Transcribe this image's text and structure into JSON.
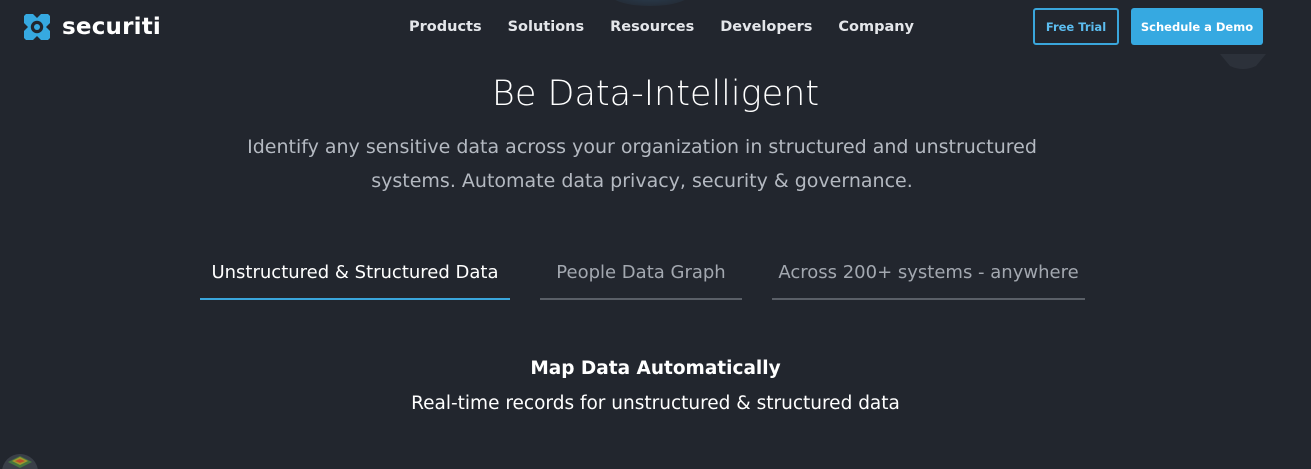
{
  "header": {
    "brand": {
      "name": "securiti",
      "logo_icon": "securiti-logo-icon",
      "logo_color": "#36a9e1"
    },
    "nav": [
      {
        "label": "Products"
      },
      {
        "label": "Solutions"
      },
      {
        "label": "Resources"
      },
      {
        "label": "Developers"
      },
      {
        "label": "Company"
      }
    ],
    "free_trial_label": "Free Trial",
    "schedule_demo_label": "Schedule a Demo"
  },
  "hero": {
    "title": "Be Data-Intelligent",
    "subtitle_line1": "Identify any sensitive data across your organization in structured and unstructured",
    "subtitle_line2": "systems. Automate data privacy, security & governance."
  },
  "tabs": [
    {
      "label": "Unstructured & Structured Data",
      "active": true
    },
    {
      "label": "People Data Graph",
      "active": false
    },
    {
      "label": "Across 200+ systems - anywhere",
      "active": false
    }
  ],
  "section": {
    "title": "Map Data Automatically",
    "subtitle": "Real-time records for unstructured & structured data"
  },
  "colors": {
    "background": "#22262e",
    "accent": "#36a9e1",
    "tab_inactive_border": "#5a5f67",
    "subtitle_text": "#b4b9c1"
  }
}
